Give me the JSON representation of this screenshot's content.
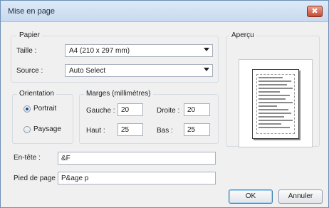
{
  "window": {
    "title": "Mise en page",
    "close_glyph": "✖"
  },
  "paper": {
    "group_label": "Papier",
    "size_label": "Taille :",
    "size_value": "A4 (210 x 297 mm)",
    "source_label": "Source :",
    "source_value": "Auto Select"
  },
  "orientation": {
    "group_label": "Orientation",
    "portrait_label": "Portrait",
    "landscape_label": "Paysage",
    "selected": "Portrait"
  },
  "margins": {
    "group_label": "Marges (millimètres)",
    "left_label": "Gauche :",
    "left_value": "20",
    "right_label": "Droite :",
    "right_value": "20",
    "top_label": "Haut :",
    "top_value": "25",
    "bottom_label": "Bas :",
    "bottom_value": "25"
  },
  "preview": {
    "group_label": "Aperçu"
  },
  "header": {
    "label": "En-tête :",
    "value": "&F"
  },
  "footer": {
    "label": "Pied de page :",
    "value": "P&age p"
  },
  "buttons": {
    "ok": "OK",
    "cancel": "Annuler"
  },
  "colors": {
    "accent": "#1c4f99",
    "title_bar": "#c7daf0",
    "close": "#c44a33"
  }
}
